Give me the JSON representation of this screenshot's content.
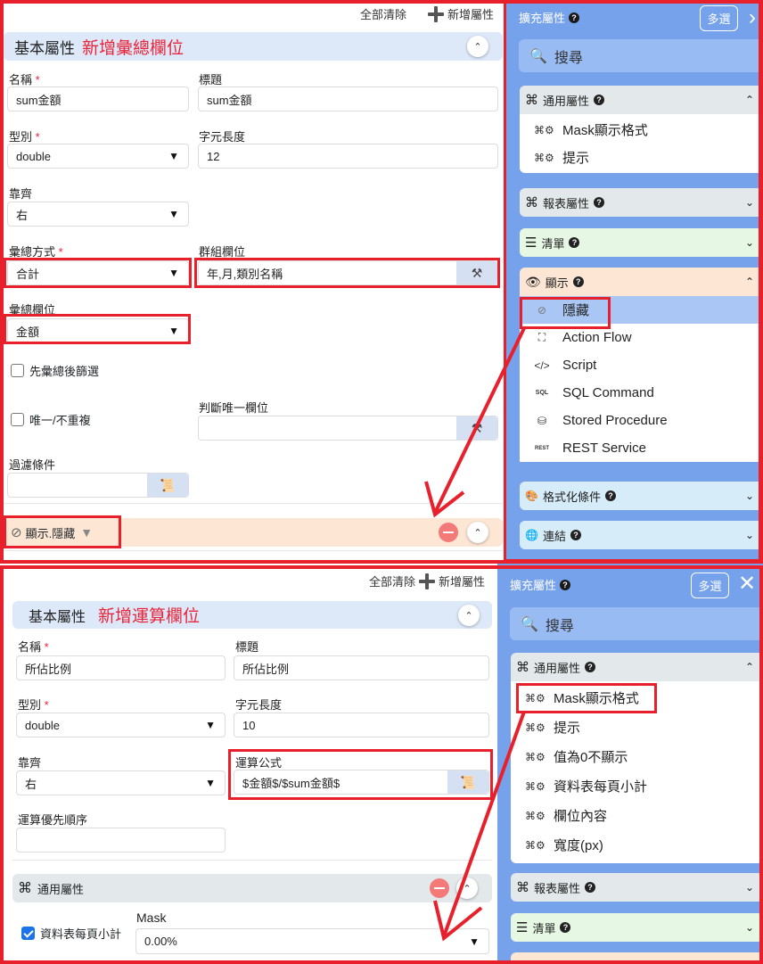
{
  "panel1": {
    "toolbar": {
      "clear_all": "全部清除",
      "add_property": "新增屬性"
    },
    "section": {
      "title": "基本屬性",
      "annotation": "新增彙總欄位"
    },
    "fields": {
      "name": {
        "label": "名稱",
        "value": "sum金額"
      },
      "caption": {
        "label": "標題",
        "value": "sum金額"
      },
      "type": {
        "label": "型別",
        "value": "double"
      },
      "length": {
        "label": "字元長度",
        "value": "12"
      },
      "align": {
        "label": "靠齊",
        "value": "右"
      },
      "agg_method": {
        "label": "彙總方式",
        "value": "合計"
      },
      "group_fields": {
        "label": "群組欄位",
        "value": "年,月,類別名稱"
      },
      "agg_field": {
        "label": "彙總欄位",
        "value": "金額"
      },
      "agg_then_filter": {
        "label": "先彙總後篩選",
        "checked": false
      },
      "unique": {
        "label": "唯一/不重複",
        "checked": false
      },
      "unique_field": {
        "label": "判斷唯一欄位",
        "value": ""
      },
      "filter": {
        "label": "過濾條件",
        "value": ""
      }
    },
    "display_section": {
      "title": "顯示.隱藏"
    },
    "sidebar": {
      "title": "擴充屬性",
      "multi_select": "多選",
      "search_placeholder": "搜尋",
      "groups": [
        {
          "label": "通用屬性",
          "expanded": true,
          "items": [
            "Mask顯示格式",
            "提示"
          ]
        },
        {
          "label": "報表屬性",
          "expanded": false
        },
        {
          "label": "清單",
          "expanded": false
        },
        {
          "label": "顯示",
          "expanded": true,
          "items": [
            "隱藏",
            "Action Flow",
            "Script",
            "SQL Command",
            "Stored Procedure",
            "REST Service"
          ],
          "selected": "隱藏"
        },
        {
          "label": "格式化條件",
          "expanded": false
        },
        {
          "label": "連結",
          "expanded": false
        }
      ],
      "item_icons": {
        "sql": "SQL",
        "rest": "REST"
      }
    }
  },
  "panel2": {
    "toolbar": {
      "clear_all": "全部清除",
      "add_property": "新增屬性"
    },
    "section": {
      "title": "基本屬性",
      "annotation": "新增運算欄位"
    },
    "fields": {
      "name": {
        "label": "名稱",
        "value": "所佔比例"
      },
      "caption": {
        "label": "標題",
        "value": "所佔比例"
      },
      "type": {
        "label": "型別",
        "value": "double"
      },
      "length": {
        "label": "字元長度",
        "value": "10"
      },
      "align": {
        "label": "靠齊",
        "value": "右"
      },
      "formula": {
        "label": "運算公式",
        "value": "$金額$/$sum金額$"
      },
      "priority": {
        "label": "運算優先順序",
        "value": ""
      }
    },
    "general_section": {
      "title": "通用屬性"
    },
    "subtotal": {
      "label": "資料表每頁小計",
      "checked": true
    },
    "mask": {
      "label": "Mask",
      "value": "0.00%"
    },
    "sidebar": {
      "title": "擴充屬性",
      "multi_select": "多選",
      "search_placeholder": "搜尋",
      "groups": [
        {
          "label": "通用屬性",
          "expanded": true,
          "items": [
            "Mask顯示格式",
            "提示",
            "值為0不顯示",
            "資料表每頁小計",
            "欄位內容",
            "寬度(px)"
          ]
        },
        {
          "label": "報表屬性",
          "expanded": false
        },
        {
          "label": "清單",
          "expanded": false
        }
      ]
    }
  },
  "colors": {
    "annotation_red": "#e8202c",
    "sidebar_blue": "#76a2ec",
    "section_blue": "#dde9f9",
    "display_peach": "#fde7d4",
    "general_gray": "#e3e8ea",
    "list_green": "#e6f7e3",
    "format_lightblue": "#d6ecf8"
  }
}
